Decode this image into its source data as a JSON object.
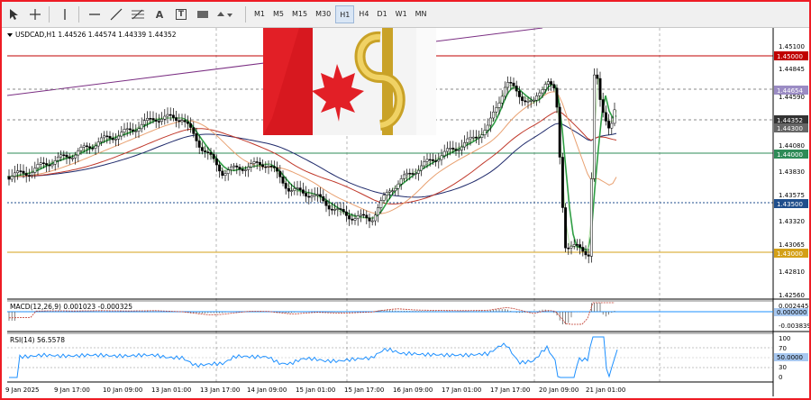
{
  "toolbar": {
    "tools": [
      "cursor-icon",
      "crosshair-icon",
      "vertical-line-icon",
      "horizontal-line-icon",
      "trendline-icon",
      "fibonacci-icon",
      "text-icon",
      "label-icon",
      "rectangle-icon",
      "shapes-icon"
    ],
    "text_tool_label": "A",
    "label_tool_label": "T",
    "timeframes": [
      "M1",
      "M5",
      "M15",
      "M30",
      "H1",
      "H4",
      "D1",
      "W1",
      "MN"
    ],
    "active_timeframe": "H1"
  },
  "header": {
    "symbol_info": "USDCAD,H1  1.44526 1.44574 1.44339 1.44352"
  },
  "price_axis": [
    "1.45100",
    "1.44845",
    "1.44590",
    "1.44335",
    "1.44080",
    "1.43830",
    "1.43575",
    "1.43320",
    "1.43065",
    "1.42810",
    "1.42560"
  ],
  "price_labels": {
    "level_145": "1.45000",
    "level_purple": "1.44654",
    "level_bid": "1.44352",
    "level_ask": "1.44300",
    "level_144": "1.44000",
    "level_1435": "1.43500",
    "level_143": "1.43000"
  },
  "macd": {
    "title": "MACD(12,26,9) 0.001023 -0.000325",
    "axis_top": "0.002445",
    "axis_bottom": "-0.003839",
    "current": "0.000000"
  },
  "rsi": {
    "title": "RSI(14) 56.5578",
    "axis": [
      "100",
      "70",
      "30",
      "0"
    ],
    "current": "50.0000"
  },
  "time_axis": [
    "9 Jan 2025",
    "9 Jan 17:00",
    "10 Jan 09:00",
    "13 Jan 01:00",
    "13 Jan 17:00",
    "14 Jan 09:00",
    "15 Jan 01:00",
    "15 Jan 17:00",
    "16 Jan 09:00",
    "17 Jan 01:00",
    "17 Jan 17:00",
    "20 Jan 09:00",
    "21 Jan 01:00"
  ],
  "colors": {
    "frame": "#ee1c25",
    "level_145": "#c00000",
    "level_144": "#2e8b57",
    "level_1435": "#1f4e8c",
    "level_143": "#d4a017",
    "ma_fast": "#2f9e44",
    "ma_slow_red": "#c0392b",
    "ma_navy": "#1f2a6b",
    "ma_orange": "#e8a070",
    "channel": "#7b2f83",
    "rsi_line": "#1e90ff",
    "macd_line": "#c0392b"
  },
  "image_logo": "canada-flag-dollar-image"
}
